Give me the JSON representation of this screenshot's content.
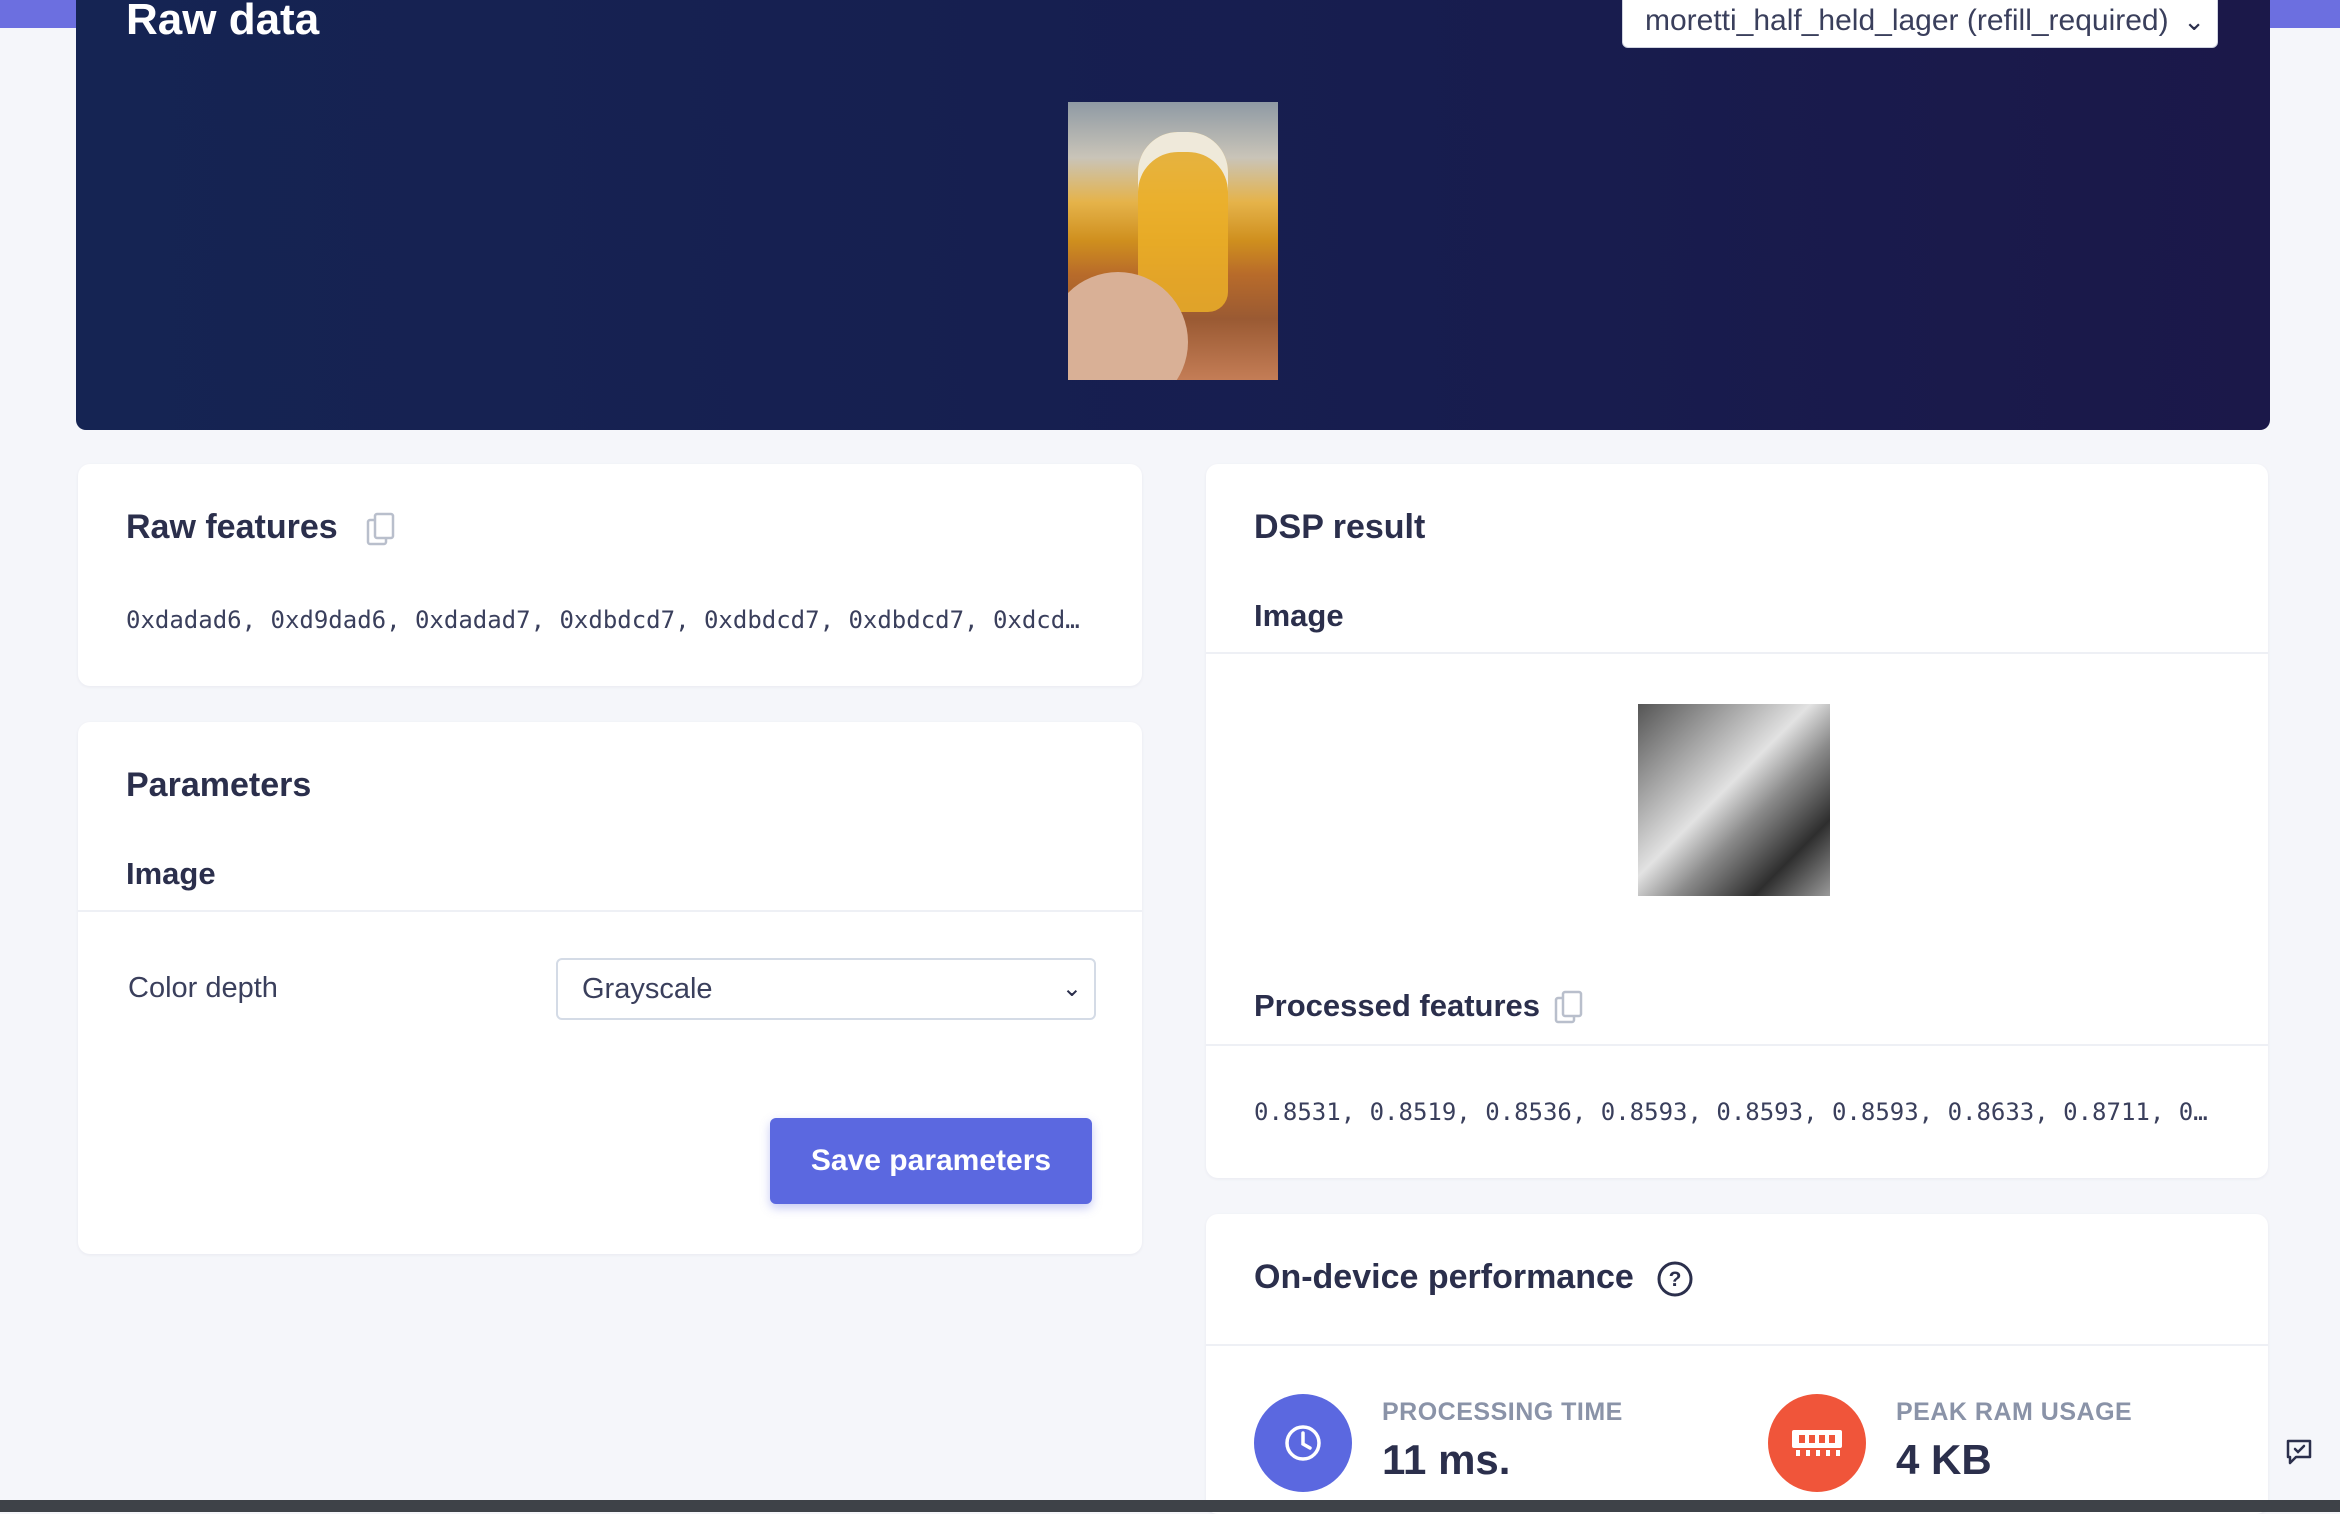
{
  "hero": {
    "title": "Raw data",
    "sample_selected": "moretti_half_held_lager (refill_required)"
  },
  "raw_features": {
    "title": "Raw features",
    "values": "0xdadad6, 0xd9dad6, 0xdadad7, 0xdbdcd7, 0xdbdcd7, 0xdbdcd7, 0xdcd…"
  },
  "parameters": {
    "title": "Parameters",
    "section": "Image",
    "color_depth_label": "Color depth",
    "color_depth_value": "Grayscale",
    "save_label": "Save parameters"
  },
  "dsp_result": {
    "title": "DSP result",
    "section": "Image",
    "processed_title": "Processed features",
    "processed_values": "0.8531, 0.8519, 0.8536, 0.8593, 0.8593, 0.8593, 0.8633, 0.8711, 0…"
  },
  "performance": {
    "title": "On-device performance",
    "processing_label": "PROCESSING TIME",
    "processing_value": "11 ms.",
    "ram_label": "PEAK RAM USAGE",
    "ram_value": "4 KB"
  },
  "colors": {
    "accent": "#5b68e0",
    "hero_bg": "#152453",
    "ram_circle": "#f0553a"
  }
}
